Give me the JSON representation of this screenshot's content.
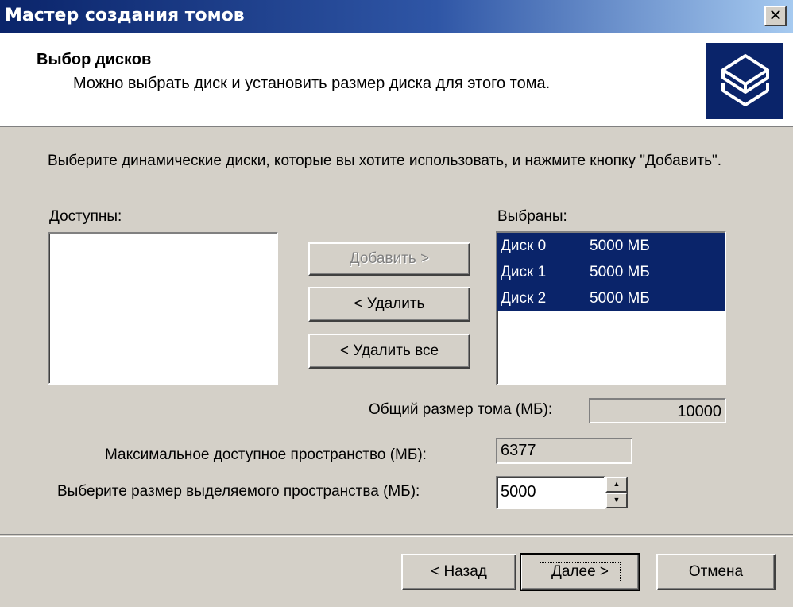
{
  "window": {
    "title": "Мастер создания томов",
    "close_label": "✕"
  },
  "header": {
    "title": "Выбор дисков",
    "subtitle": "Можно выбрать диск и установить размер диска для этого тома.",
    "icon": "disks-icon"
  },
  "instructions": "Выберите динамические диски, которые вы хотите использовать, и нажмите кнопку \"Добавить\".",
  "available": {
    "label": "Доступны:",
    "items": []
  },
  "selected": {
    "label": "Выбраны:",
    "items": [
      {
        "name": "Диск 0",
        "size": "5000 МБ"
      },
      {
        "name": "Диск 1",
        "size": "5000 МБ"
      },
      {
        "name": "Диск 2",
        "size": "5000 МБ"
      }
    ]
  },
  "buttons": {
    "add": "Добавить >",
    "remove": "< Удалить",
    "remove_all": "< Удалить все",
    "back": "< Назад",
    "next": "Далее >",
    "cancel": "Отмена"
  },
  "total_size": {
    "label": "Общий размер тома (МБ):",
    "value": "10000"
  },
  "max_space": {
    "label": "Максимальное доступное пространство (МБ):",
    "value": "6377"
  },
  "alloc_size": {
    "label": "Выберите размер выделяемого пространства (МБ):",
    "value": "5000"
  },
  "colors": {
    "selection": "#0a246a",
    "face": "#d4d0c8"
  }
}
